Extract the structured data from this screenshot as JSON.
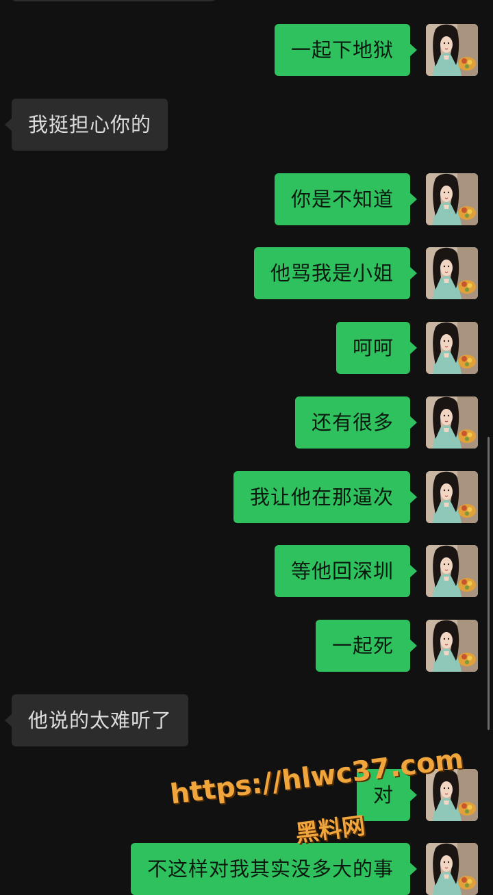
{
  "messages": [
    {
      "side": "out",
      "text": "一起下地狱"
    },
    {
      "side": "in",
      "text": "我挺担心你的"
    },
    {
      "side": "out",
      "text": "你是不知道"
    },
    {
      "side": "out",
      "text": "他骂我是小姐"
    },
    {
      "side": "out",
      "text": "呵呵"
    },
    {
      "side": "out",
      "text": "还有很多"
    },
    {
      "side": "out",
      "text": "我让他在那逼次"
    },
    {
      "side": "out",
      "text": "等他回深圳"
    },
    {
      "side": "out",
      "text": "一起死"
    },
    {
      "side": "in",
      "text": "他说的太难听了"
    },
    {
      "side": "out",
      "text": "对"
    },
    {
      "side": "out",
      "text": "不这样对我其实没多大的事"
    }
  ],
  "watermark": {
    "url": "https://hlwc37.com",
    "name": "黑料网"
  },
  "colors": {
    "background": "#111111",
    "outgoing_bubble": "#2fc15e",
    "incoming_bubble": "#2c2c2c",
    "watermark": "#f0a63c"
  },
  "icons": {
    "avatar": "user-avatar-photo"
  }
}
